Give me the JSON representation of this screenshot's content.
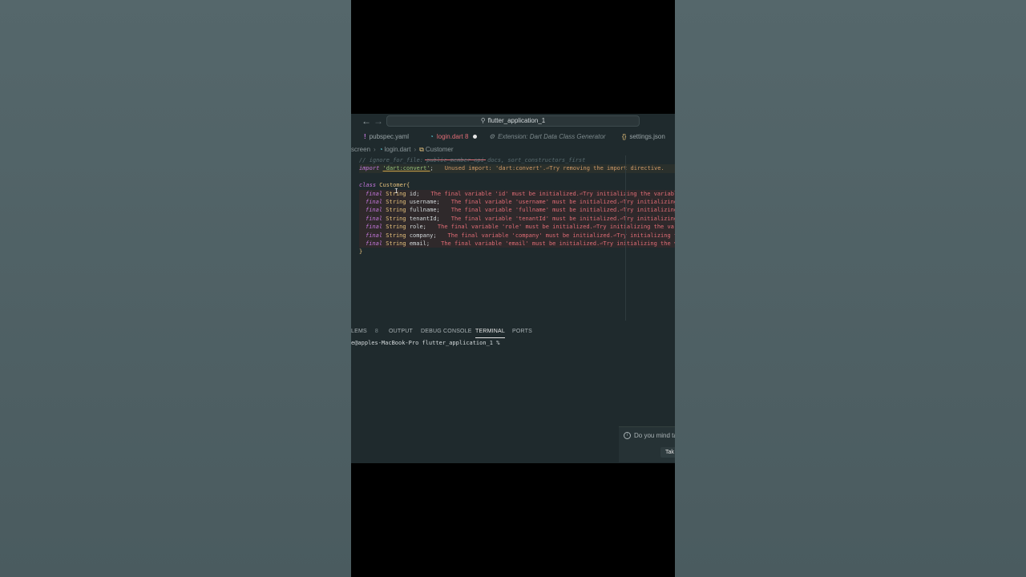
{
  "titlebar": {
    "back_icon": "arrow-left-icon",
    "forward_icon": "arrow-right-icon",
    "search_text": "flutter_application_1"
  },
  "tabs": [
    {
      "label": "pubspec.yaml",
      "icon": "!"
    },
    {
      "label": "login.dart 8",
      "icon": "dart-icon",
      "modified": true
    },
    {
      "label": "Extension: Dart Data Class Generator",
      "icon": "gear-icon"
    },
    {
      "label": "settings.json",
      "icon": "{}"
    }
  ],
  "breadcrumb": {
    "part1": "screen",
    "part2": "login.dart",
    "part3": "Customer"
  },
  "code": {
    "comment": "// ignore_for_file: public_member_api_docs, sort_constructors_first",
    "import_kw": "import",
    "import_str": "'dart:convert'",
    "import_semi": ";",
    "import_warn": "Unused import: 'dart:convert'.⏎Try removing the import directive.",
    "class_kw": "class",
    "class_name": "Customer",
    "brace_open": "{",
    "brace_close": "}",
    "fields": [
      {
        "kw": "final",
        "type": "String",
        "name": "id;",
        "msg": "The final variable 'id' must be initialized.⏎Try initializing the variable."
      },
      {
        "kw": "final",
        "type": "String",
        "name": "username;",
        "msg": "The final variable 'username' must be initialized.⏎Try initializing the variable."
      },
      {
        "kw": "final",
        "type": "String",
        "name": "fullname;",
        "msg": "The final variable 'fullname' must be initialized.⏎Try initializing the variable."
      },
      {
        "kw": "final",
        "type": "String",
        "name": "tenantId;",
        "msg": "The final variable 'tenantId' must be initialized.⏎Try initializing the variable."
      },
      {
        "kw": "final",
        "type": "String",
        "name": "role;",
        "msg": "The final variable 'role' must be initialized.⏎Try initializing the variable."
      },
      {
        "kw": "final",
        "type": "String",
        "name": "company;",
        "msg": "The final variable 'company' must be initialized.⏎Try initializing the variable."
      },
      {
        "kw": "final",
        "type": "String",
        "name": "email;",
        "msg": "The final variable 'email' must be initialized.⏎Try initializing the variable."
      }
    ]
  },
  "panel": {
    "problems": "LEMS",
    "problems_count": "8",
    "output": "OUTPUT",
    "debug": "DEBUG CONSOLE",
    "terminal": "TERMINAL",
    "ports": "PORTS"
  },
  "terminal": {
    "prompt": "e@apples-MacBook-Pro flutter_application_1 %"
  },
  "notification": {
    "text": "Do you mind ta",
    "button": "Tak"
  }
}
